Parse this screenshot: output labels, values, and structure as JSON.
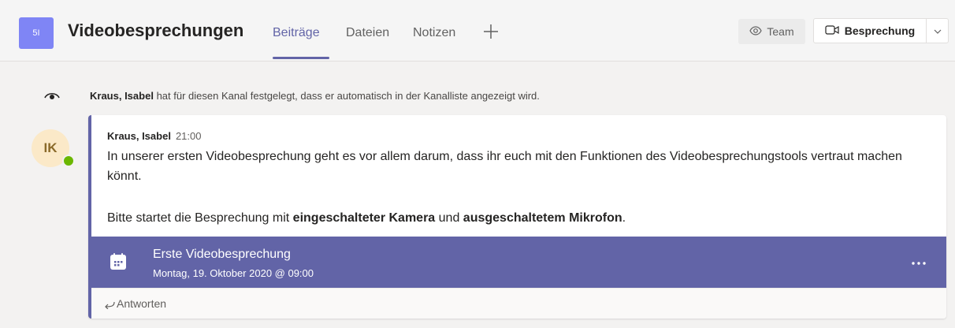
{
  "header": {
    "team_initials": "5I",
    "channel_title": "Videobesprechungen",
    "tabs": [
      {
        "label": "Beiträge",
        "active": true
      },
      {
        "label": "Dateien",
        "active": false
      },
      {
        "label": "Notizen",
        "active": false
      }
    ],
    "add_tab_icon": "plus-icon",
    "team_button": {
      "label": "Team",
      "icon": "eye-icon"
    },
    "meet_button": {
      "label": "Besprechung",
      "icon": "video-camera-icon",
      "dropdown_icon": "chevron-down-icon"
    }
  },
  "system_message": {
    "icon": "eye-icon",
    "actor": "Kraus, Isabel",
    "text": "hat für diesen Kanal festgelegt, dass er automatisch in der Kanalliste angezeigt wird."
  },
  "post": {
    "avatar_initials": "IK",
    "presence": "available",
    "author": "Kraus, Isabel",
    "time": "21:00",
    "paragraph1": "In unserer ersten Videobesprechung geht es vor allem darum, dass ihr euch mit den Funktionen des Videobesprechungstools vertraut machen könnt.",
    "paragraph2": {
      "part1": "Bitte startet die Besprechung mit ",
      "bold1": "eingeschalteter Kamera",
      "part2": " und ",
      "bold2": "ausgeschaltetem Mikrofon",
      "part3": "."
    },
    "meeting": {
      "icon": "calendar-icon",
      "title": "Erste Videobesprechung",
      "datetime": "Montag, 19. Oktober 2020 @ 09:00",
      "more_icon": "more-options-icon"
    },
    "reply": {
      "icon": "reply-arrow-icon",
      "label": "Antworten"
    }
  },
  "colors": {
    "accent": "#6264a7",
    "team_avatar": "#7f85f5",
    "presence": "#6bb700",
    "user_avatar_bg": "#fbe9c8"
  }
}
